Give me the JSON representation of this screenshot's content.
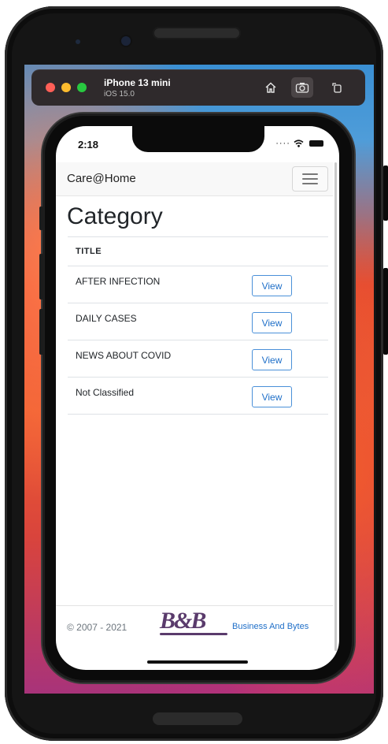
{
  "simulator": {
    "device_name": "iPhone 13 mini",
    "os_version": "iOS 15.0",
    "toolbar_icons": [
      "home-icon",
      "screenshot-icon",
      "rotate-icon"
    ],
    "window_dot_colors": {
      "close": "#ff5f57",
      "minimize": "#febc2e",
      "zoom": "#28c840"
    }
  },
  "status_bar": {
    "time": "2:18",
    "icons": [
      "signal-icon",
      "wifi-icon",
      "battery-icon"
    ]
  },
  "navbar": {
    "brand": "Care@Home",
    "menu_icon": "hamburger-icon"
  },
  "page": {
    "title": "Category"
  },
  "table": {
    "header": "TITLE",
    "rows": [
      {
        "title": "AFTER INFECTION",
        "action": "View"
      },
      {
        "title": "DAILY CASES",
        "action": "View"
      },
      {
        "title": "NEWS ABOUT COVID",
        "action": "View"
      },
      {
        "title": "Not Classified",
        "action": "View"
      }
    ]
  },
  "footer": {
    "copyright": "© 2007 - 2021",
    "logo_text": "B&B",
    "company_link": "Business And Bytes"
  },
  "colors": {
    "link_blue": "#1f6fc8",
    "button_border": "#4a90d9",
    "logo_purple": "#5a3b6c"
  }
}
